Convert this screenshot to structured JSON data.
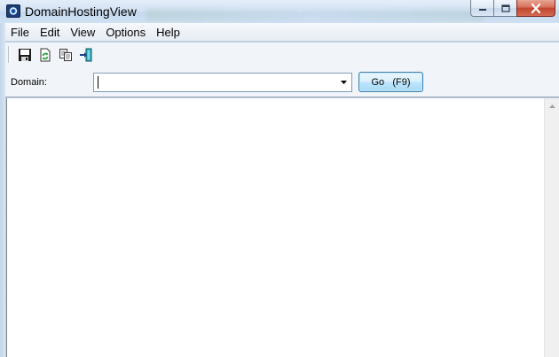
{
  "window": {
    "title": "DomainHostingView",
    "caption_buttons": [
      "minimize",
      "maximize",
      "close"
    ]
  },
  "menu": {
    "items": [
      "File",
      "Edit",
      "View",
      "Options",
      "Help"
    ]
  },
  "toolbar": {
    "buttons": [
      {
        "icon": "save-icon"
      },
      {
        "icon": "refresh-icon"
      },
      {
        "icon": "copy-icon"
      },
      {
        "icon": "exit-icon"
      }
    ]
  },
  "domain_row": {
    "label": "Domain:",
    "value": "",
    "go_label": "Go   (F9)"
  },
  "colors": {
    "titlebar": "#d3e2f3",
    "close_button": "#c2462f",
    "go_button": "#bee6fd",
    "chrome": "#f1f4f8"
  }
}
